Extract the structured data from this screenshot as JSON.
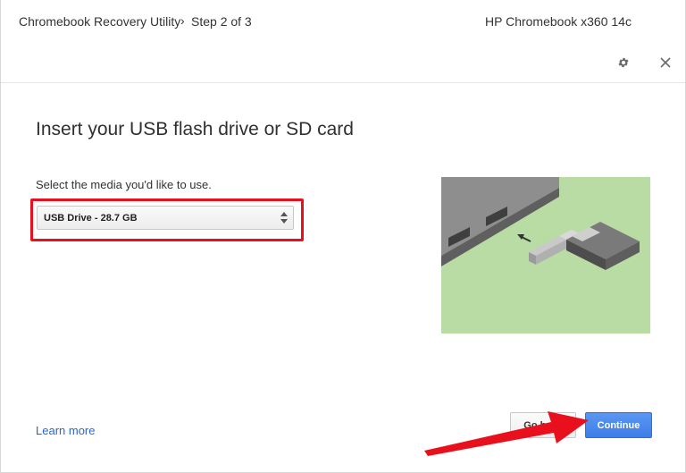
{
  "header": {
    "app_title": "Chromebook Recovery Utility",
    "separator": "›",
    "step": "Step 2 of 3",
    "device_name": "HP Chromebook x360 14c",
    "settings_icon": "gear-icon",
    "close_icon": "close-icon"
  },
  "main": {
    "heading": "Insert your USB flash drive or SD card",
    "select_label": "Select the media you'd like to use.",
    "media_select": {
      "selected": "USB Drive - 28.7 GB"
    },
    "illustration": "usb-insert-illustration"
  },
  "footer": {
    "learn_more": "Learn more",
    "go_back_label": "Go back",
    "continue_label": "Continue"
  },
  "colors": {
    "accent_blue": "#4285f4",
    "highlight_red": "#e8101c",
    "illustration_green": "#b8dca4"
  }
}
